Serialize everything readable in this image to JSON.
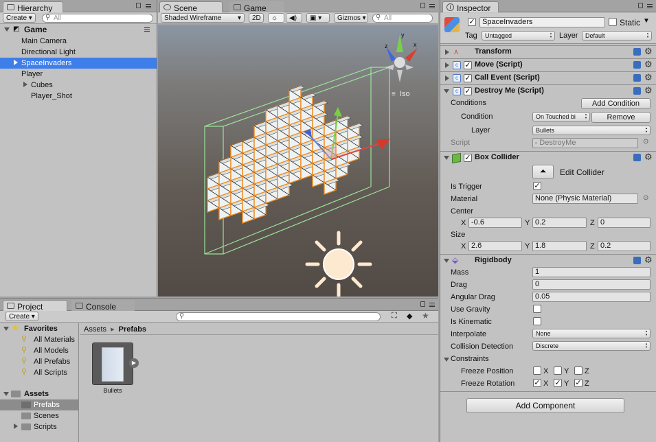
{
  "hierarchy": {
    "tab": "Hierarchy",
    "create": "Create ▾",
    "search_placeholder": "All",
    "root": "Game",
    "items": [
      "Main Camera",
      "Directional Light",
      "SpaceInvaders",
      "Player",
      "Cubes",
      "Player_Shot"
    ]
  },
  "scene": {
    "tab_scene": "Scene",
    "tab_game": "Game",
    "shading": "Shaded Wireframe",
    "mode_2d": "2D",
    "gizmos": "Gizmos ▾",
    "search_placeholder": "All",
    "gizmo_x": "x",
    "gizmo_y": "y",
    "gizmo_z": "z",
    "iso": "Iso"
  },
  "project": {
    "tab_project": "Project",
    "tab_console": "Console",
    "create": "Create ▾",
    "favorites_label": "Favorites",
    "favorites": [
      "All Materials",
      "All Models",
      "All Prefabs",
      "All Scripts"
    ],
    "assets_label": "Assets",
    "assets_children": [
      "Prefabs",
      "Scenes",
      "Scripts"
    ],
    "breadcrumb_root": "Assets",
    "breadcrumb_sep": "▸",
    "breadcrumb_current": "Prefabs",
    "asset_name": "Bullets"
  },
  "inspector": {
    "tab": "Inspector",
    "object_name": "SpaceInvaders",
    "static_label": "Static",
    "tag_label": "Tag",
    "tag_value": "Untagged",
    "layer_label": "Layer",
    "layer_value": "Default",
    "transform": "Transform",
    "move": "Move (Script)",
    "call_event": "Call Event (Script)",
    "destroy_me": "Destroy Me (Script)",
    "conditions_label": "Conditions",
    "add_condition": "Add Condition",
    "condition_label": "Condition",
    "condition_value": "On Touched bi",
    "remove": "Remove",
    "cond_layer_label": "Layer",
    "cond_layer_value": "Bullets",
    "script_label": "Script",
    "script_value": "DestroyMe",
    "box_collider": "Box Collider",
    "edit_collider": "Edit Collider",
    "is_trigger": "Is Trigger",
    "material_label": "Material",
    "material_value": "None (Physic Material)",
    "center_label": "Center",
    "center": {
      "x": "-0.6",
      "y": "0.2",
      "z": "0"
    },
    "size_label": "Size",
    "size": {
      "x": "2.6",
      "y": "1.8",
      "z": "0.2"
    },
    "axis_x": "X",
    "axis_y": "Y",
    "axis_z": "Z",
    "rigidbody": "Rigidbody",
    "mass_label": "Mass",
    "mass": "1",
    "drag_label": "Drag",
    "drag": "0",
    "angular_drag_label": "Angular Drag",
    "angular_drag": "0.05",
    "use_gravity": "Use Gravity",
    "is_kinematic": "Is Kinematic",
    "interpolate_label": "Interpolate",
    "interpolate_value": "None",
    "collision_label": "Collision Detection",
    "collision_value": "Discrete",
    "constraints": "Constraints",
    "freeze_position": "Freeze Position",
    "freeze_rotation": "Freeze Rotation",
    "add_component": "Add Component"
  },
  "colors": {
    "selection": "#3e7ee9",
    "scene_bg_top": "#8b96a3",
    "scene_bg_bottom": "#514a45",
    "selection_outline": "#f08a1c",
    "collider_green": "#9ce29a"
  }
}
